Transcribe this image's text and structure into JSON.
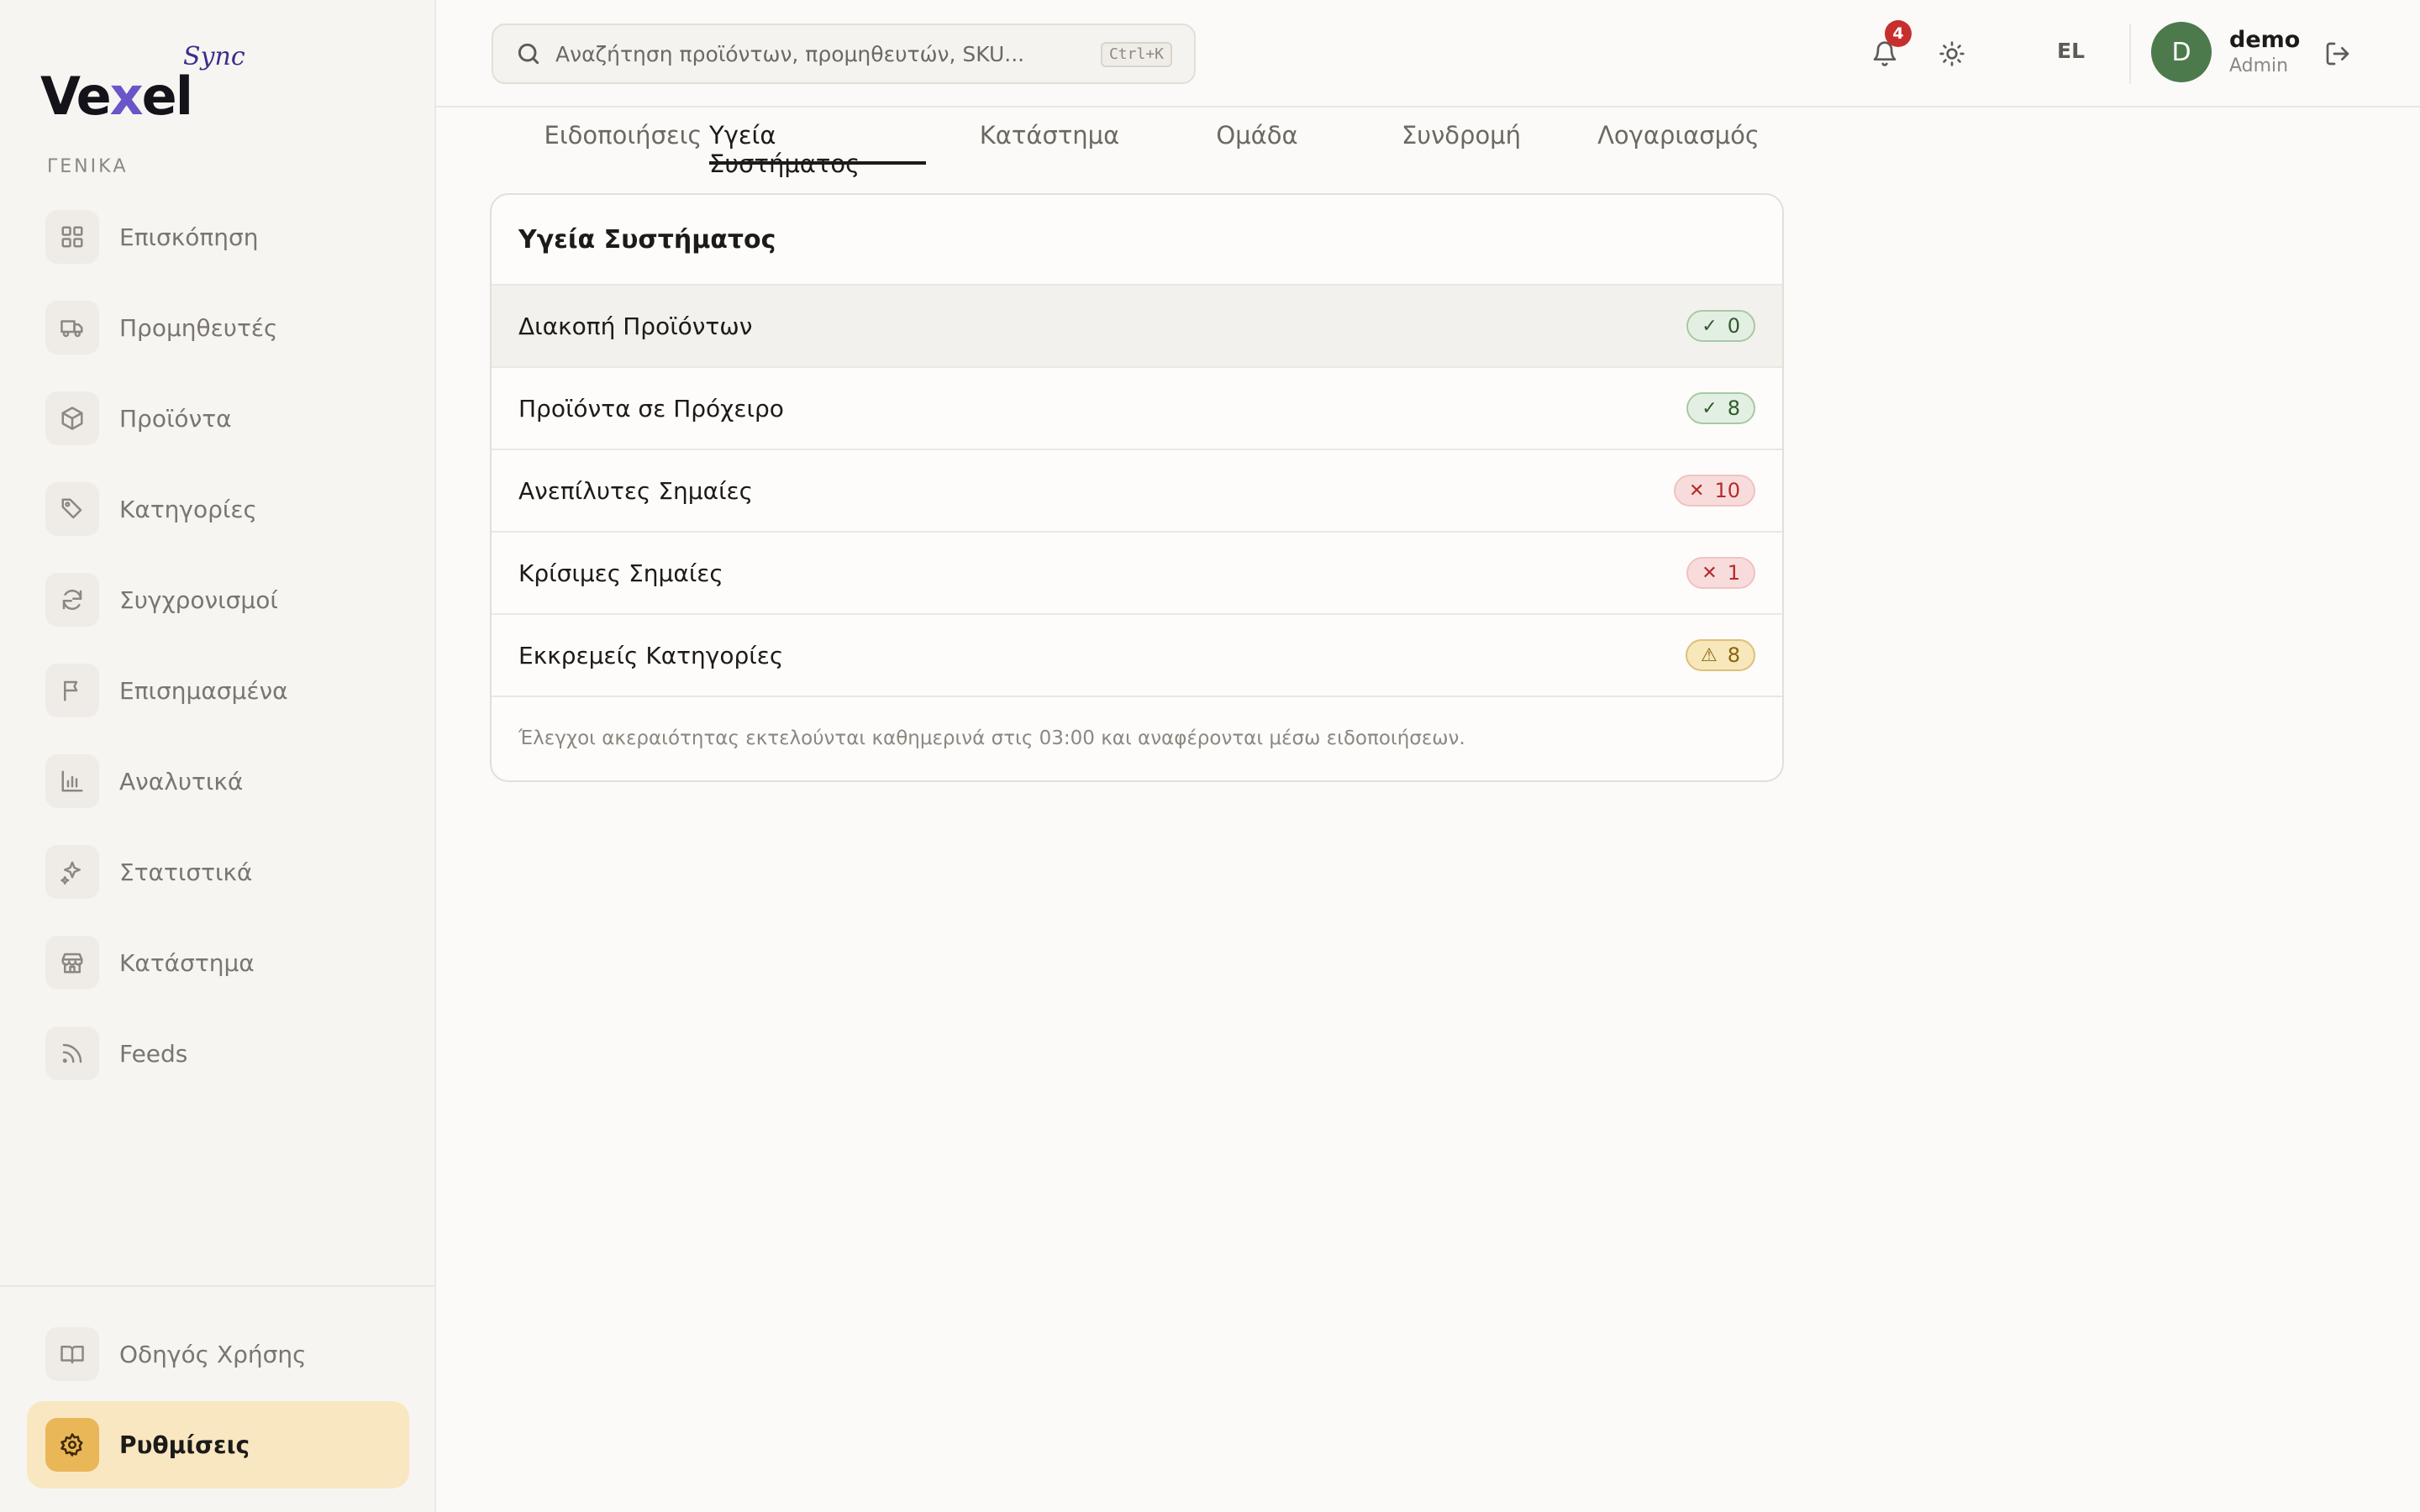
{
  "brand": {
    "main_prefix": "Ve",
    "main_x": "x",
    "main_suffix": "el",
    "sub": "Sync"
  },
  "sidebar": {
    "section_label": "ΓΕΝΙΚΑ",
    "items": [
      {
        "label": "Επισκόπηση",
        "icon": "grid-icon"
      },
      {
        "label": "Προμηθευτές",
        "icon": "truck-icon"
      },
      {
        "label": "Προϊόντα",
        "icon": "box-icon"
      },
      {
        "label": "Κατηγορίες",
        "icon": "tag-icon"
      },
      {
        "label": "Συγχρονισμοί",
        "icon": "sync-icon"
      },
      {
        "label": "Επισημασμένα",
        "icon": "flag-icon"
      },
      {
        "label": "Αναλυτικά",
        "icon": "bar-chart-icon"
      },
      {
        "label": "Στατιστικά",
        "icon": "sparkles-icon"
      },
      {
        "label": "Κατάστημα",
        "icon": "store-icon"
      },
      {
        "label": "Feeds",
        "icon": "rss-icon"
      }
    ],
    "bottom_items": [
      {
        "label": "Οδηγός Χρήσης",
        "icon": "book-icon"
      },
      {
        "label": "Ρυθμίσεις",
        "icon": "gear-icon",
        "active": true
      }
    ]
  },
  "header": {
    "search_placeholder": "Αναζήτηση προϊόντων, προμηθευτών, SKU...",
    "search_shortcut": "Ctrl+K",
    "notification_count": "4",
    "language": "EL",
    "user": {
      "initial": "D",
      "name": "demo",
      "role": "Admin"
    }
  },
  "tabs": [
    {
      "label": "Ειδοποιήσεις"
    },
    {
      "label": "Υγεία Συστήματος",
      "active": true
    },
    {
      "label": "Κατάστημα"
    },
    {
      "label": "Ομάδα"
    },
    {
      "label": "Συνδρομή"
    },
    {
      "label": "Λογαριασμός"
    }
  ],
  "health": {
    "title": "Υγεία Συστήματος",
    "rows": [
      {
        "label": "Διακοπή Προϊόντων",
        "status": "ok",
        "symbol": "✓",
        "value": "0"
      },
      {
        "label": "Προϊόντα σε Πρόχειρο",
        "status": "ok",
        "symbol": "✓",
        "value": "8"
      },
      {
        "label": "Ανεπίλυτες Σημαίες",
        "status": "err",
        "symbol": "✕",
        "value": "10"
      },
      {
        "label": "Κρίσιμες Σημαίες",
        "status": "err",
        "symbol": "✕",
        "value": "1"
      },
      {
        "label": "Εκκρεμείς Κατηγορίες",
        "status": "warn",
        "symbol": "⚠",
        "value": "8"
      }
    ],
    "note": "Έλεγχοι ακεραιότητας εκτελούνται καθημερινά στις 03:00 και αναφέρονται μέσω ειδοποιήσεων."
  },
  "colors": {
    "accent_active_bg": "#f9e7c2",
    "accent_active_icon": "#e9b658",
    "avatar": "#4c7a4c",
    "badge_red": "#c72f2f"
  }
}
